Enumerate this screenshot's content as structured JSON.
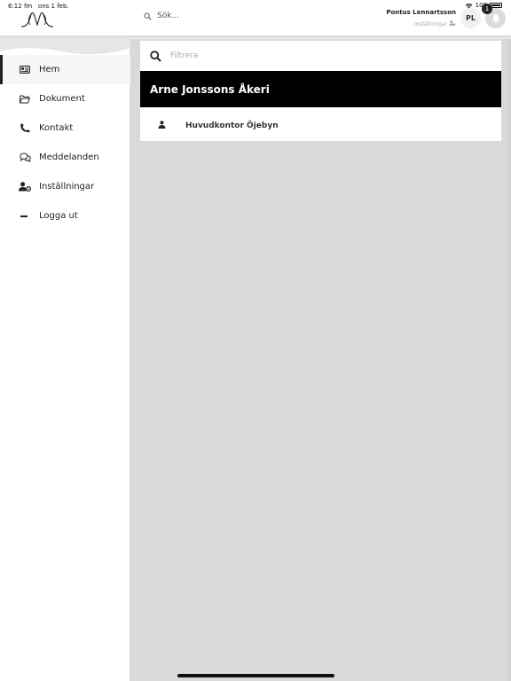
{
  "status_bar": {
    "time": "6:12 fm",
    "date": "ons 1 feb.",
    "battery": "100"
  },
  "header": {
    "search_placeholder": "Sök...",
    "user_name": "Pontus Lennartsson",
    "settings_label": "Inställningar",
    "avatar_initials": "PL",
    "notification_count": "1"
  },
  "sidebar": {
    "items": [
      {
        "label": "Hem",
        "icon": "card-icon",
        "active": true
      },
      {
        "label": "Dokument",
        "icon": "folder-icon"
      },
      {
        "label": "Kontakt",
        "icon": "phone-icon"
      },
      {
        "label": "Meddelanden",
        "icon": "chat-icon"
      },
      {
        "label": "Inställningar",
        "icon": "user-settings-icon"
      },
      {
        "label": "Logga ut",
        "icon": "minus-icon"
      }
    ]
  },
  "main": {
    "filter_placeholder": "Filtrera",
    "company_name": "Arne Jonssons Åkeri",
    "offices": [
      {
        "name": "Huvudkontor Öjebyn",
        "icon": "person-icon"
      }
    ]
  }
}
